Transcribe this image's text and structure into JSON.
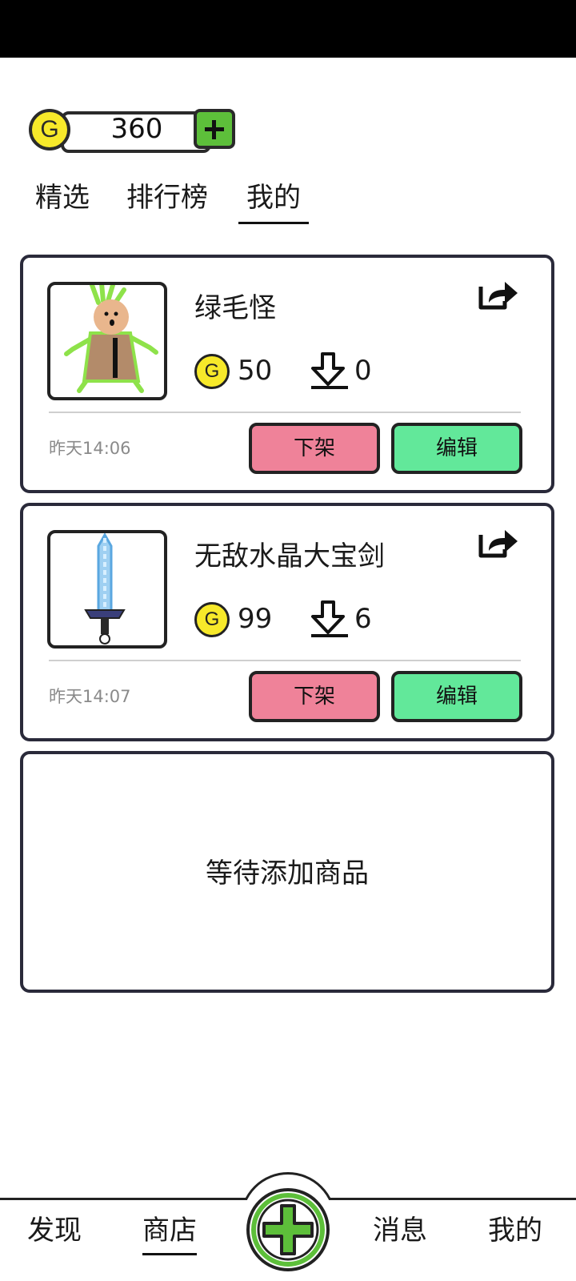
{
  "wallet": {
    "coin_symbol": "G",
    "balance": "360"
  },
  "top_tabs": [
    {
      "label": "精选",
      "active": false
    },
    {
      "label": "排行榜",
      "active": false
    },
    {
      "label": "我的",
      "active": true
    }
  ],
  "items": [
    {
      "name": "绿毛怪",
      "price": "50",
      "downloads": "0",
      "date": "昨天14:06",
      "unlist_label": "下架",
      "edit_label": "编辑",
      "thumbnail": "green-monster-drawing"
    },
    {
      "name": "无敌水晶大宝剑",
      "price": "99",
      "downloads": "6",
      "date": "昨天14:07",
      "unlist_label": "下架",
      "edit_label": "编辑",
      "thumbnail": "crystal-sword-drawing"
    }
  ],
  "empty_slot": {
    "text": "等待添加商品"
  },
  "bottom_nav": [
    {
      "label": "发现",
      "active": false
    },
    {
      "label": "商店",
      "active": true
    },
    {
      "label": "消息",
      "active": false
    },
    {
      "label": "我的",
      "active": false
    }
  ],
  "colors": {
    "coin_yellow": "#f7e92a",
    "add_green": "#5dbf3a",
    "unlist_pink": "#ef8299",
    "edit_green": "#62e89a"
  }
}
